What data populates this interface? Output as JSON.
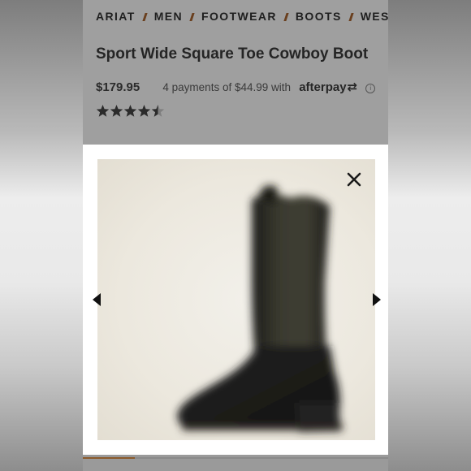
{
  "breadcrumb": {
    "items": [
      "ARIAT",
      "MEN",
      "FOOTWEAR",
      "BOOTS",
      "WESTERN"
    ]
  },
  "product": {
    "title": "Sport Wide Square Toe Cowboy Boot",
    "price": "$179.95",
    "installments": "4 payments of $44.99 with",
    "afterpay_brand": "afterpay",
    "rating_stars": 4.5
  },
  "gallery": {
    "image_subject": "black cowboy boot",
    "progress_fraction": 0.17
  },
  "icons": {
    "close": "close-icon",
    "prev": "chevron-left-icon",
    "next": "chevron-right-icon",
    "info": "info-icon",
    "afterpay": "afterpay-arrows-icon"
  },
  "colors": {
    "accent": "#8b5a2b",
    "text": "#252525"
  }
}
